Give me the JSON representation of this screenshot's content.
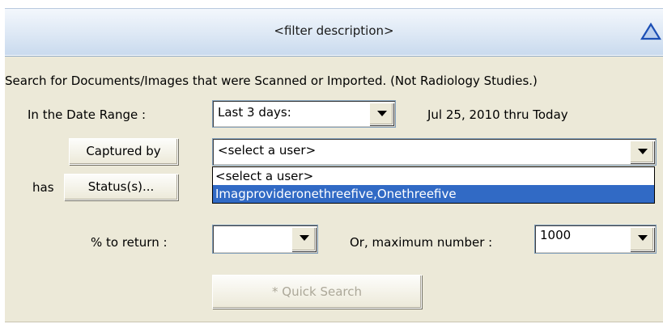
{
  "header": {
    "title": "<filter description>"
  },
  "description": "Search for Documents/Images that were Scanned or Imported.  (Not Radiology Studies.)",
  "date_range": {
    "label": "In the Date Range :",
    "selected": "Last 3 days:",
    "range_text": "Jul 25, 2010 thru Today"
  },
  "captured_by": {
    "button_label": "Captured by",
    "selected": "<select a user>",
    "options": [
      "<select a user>",
      "Imagprovideronethreefive,Onethreefive"
    ],
    "highlighted_index": 1
  },
  "status": {
    "prefix": "has",
    "button_label": "Status(s)..."
  },
  "percent_return": {
    "label": "% to return :",
    "selected": ""
  },
  "max_number": {
    "label": "Or,  maximum number :",
    "selected": "1000"
  },
  "quick_search": {
    "label": "* Quick Search",
    "enabled": false
  },
  "icons": {
    "collapse": "triangle-up-icon",
    "dropdown": "chevron-down-icon"
  },
  "colors": {
    "highlight": "#316ac5",
    "panel": "#ece9d8",
    "collapse_icon": "#1c4fb5"
  }
}
